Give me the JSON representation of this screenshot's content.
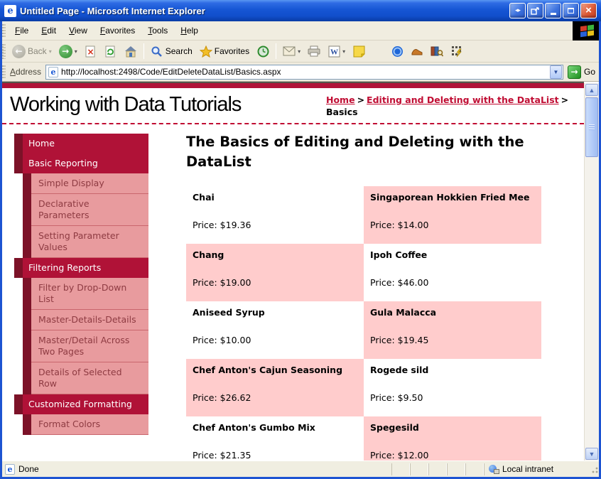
{
  "titlebar": {
    "title": "Untitled Page - Microsoft Internet Explorer"
  },
  "menubar": {
    "items": [
      "File",
      "Edit",
      "View",
      "Favorites",
      "Tools",
      "Help"
    ]
  },
  "toolbar": {
    "back_label": "Back",
    "search_label": "Search",
    "favorites_label": "Favorites"
  },
  "addressbar": {
    "label": "Address",
    "url": "http://localhost:2498/Code/EditDeleteDataList/Basics.aspx",
    "go_label": "Go"
  },
  "header": {
    "site_title": "Working with Data Tutorials",
    "breadcrumb": {
      "home": "Home",
      "sep1": ">",
      "section": "Editing and Deleting with the DataList",
      "sep2": ">",
      "current": "Basics"
    }
  },
  "sidebar": {
    "items": [
      {
        "label": "Home"
      },
      {
        "label": "Basic Reporting"
      },
      {
        "label": "Simple Display"
      },
      {
        "label": "Declarative Parameters"
      },
      {
        "label": "Setting Parameter Values"
      },
      {
        "label": "Filtering Reports"
      },
      {
        "label": "Filter by Drop-Down List"
      },
      {
        "label": "Master-Details-Details"
      },
      {
        "label": "Master/Detail Across Two Pages"
      },
      {
        "label": "Details of Selected Row"
      },
      {
        "label": "Customized Formatting"
      },
      {
        "label": "Format Colors"
      }
    ]
  },
  "main": {
    "heading": "The Basics of Editing and Deleting with the DataList",
    "products": [
      {
        "name": "Chai",
        "price": "Price: $19.36"
      },
      {
        "name": "Singaporean Hokkien Fried Mee",
        "price": "Price: $14.00"
      },
      {
        "name": "Chang",
        "price": "Price: $19.00"
      },
      {
        "name": "Ipoh Coffee",
        "price": "Price: $46.00"
      },
      {
        "name": "Aniseed Syrup",
        "price": "Price: $10.00"
      },
      {
        "name": "Gula Malacca",
        "price": "Price: $19.45"
      },
      {
        "name": "Chef Anton's Cajun Seasoning",
        "price": "Price: $26.62"
      },
      {
        "name": "Rogede sild",
        "price": "Price: $9.50"
      },
      {
        "name": "Chef Anton's Gumbo Mix",
        "price": "Price: $21.35"
      },
      {
        "name": "Spegesild",
        "price": "Price: $12.00"
      }
    ]
  },
  "statusbar": {
    "status": "Done",
    "zone": "Local intranet"
  },
  "colors": {
    "crimson": "#B01237",
    "maroon": "#7C1228",
    "sidebar_pink": "#E89B9E",
    "cell_pink": "#FFCCCC",
    "link_red": "#C00D33",
    "xp_blue": "#1D54D2"
  }
}
